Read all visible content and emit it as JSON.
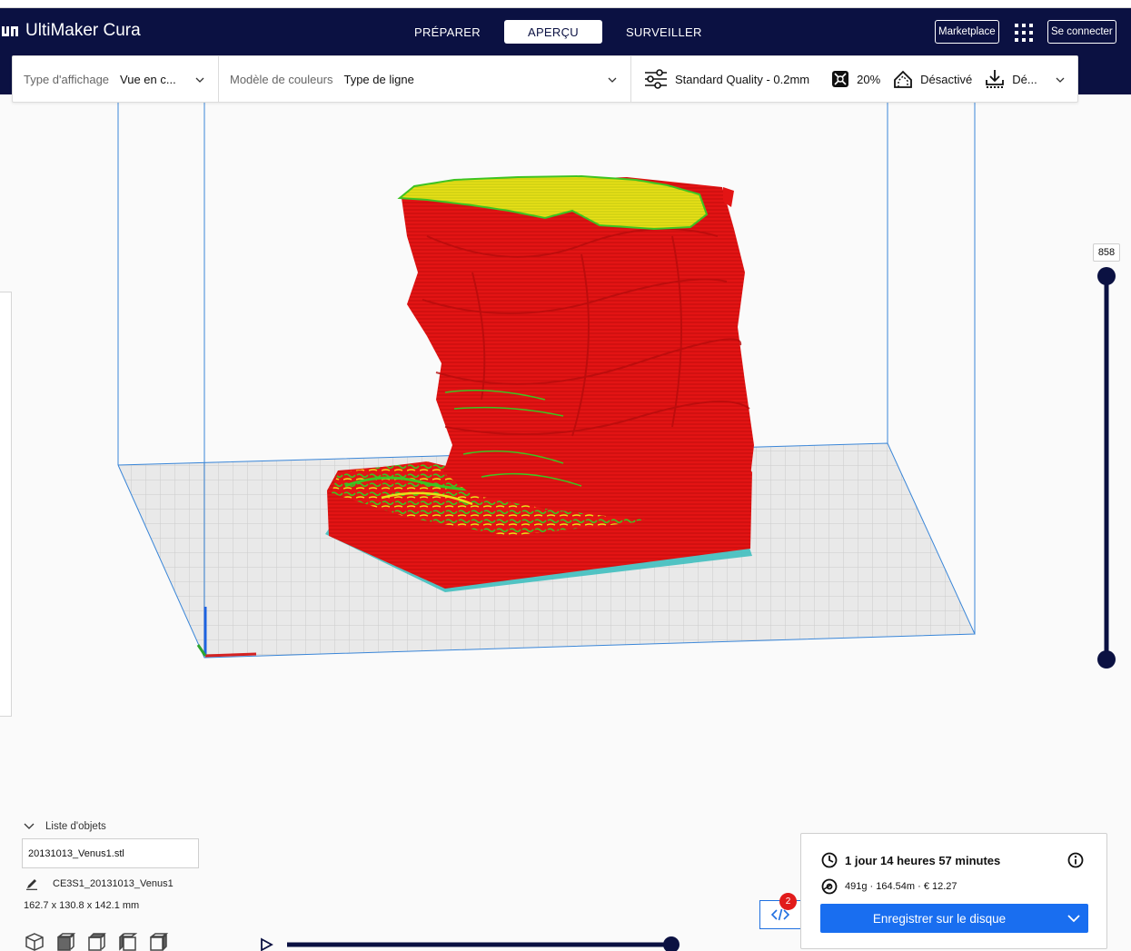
{
  "app": {
    "title": "UltiMaker Cura"
  },
  "stages": [
    {
      "label": "PRÉPARER",
      "active": false
    },
    {
      "label": "APERÇU",
      "active": true
    },
    {
      "label": "SURVEILLER",
      "active": false
    }
  ],
  "header": {
    "marketplace_label": "Marketplace",
    "signin_label": "Se connecter"
  },
  "toolbar": {
    "view_type_label": "Type d'affichage",
    "view_type_value": "Vue en c...",
    "color_scheme_label": "Modèle de couleurs",
    "color_scheme_value": "Type de ligne",
    "quality_label": "Standard Quality - 0.2mm",
    "infill_label": "20%",
    "support_label": "Désactivé",
    "adhesion_label": "Dé..."
  },
  "layer_slider": {
    "current_layer": "858"
  },
  "objects": {
    "header_label": "Liste d'objets",
    "file_name": "20131013_Venus1.stl",
    "profile_name": "CE3S1_20131013_Venus1",
    "dimensions": "162.7 x 130.8 x 142.1 mm"
  },
  "notifications": {
    "count": "2"
  },
  "print": {
    "time": "1 jour 14 heures 57 minutes",
    "material": "491g · 164.54m · € 12.27",
    "save_label": "Enregistrer sur le disque"
  },
  "colors": {
    "header_bg": "#0b1142",
    "accent_blue": "#196ef0",
    "model_red": "#e31414",
    "model_yellow": "#e8e017",
    "model_green": "#3ec321",
    "build_volume_line": "#3a86d8",
    "badge_red": "#e11b1b"
  },
  "icons": {
    "logo": "ultimaker-logo-icon",
    "apps": "apps-grid-icon",
    "quality": "sliders-icon",
    "infill": "infill-icon",
    "support": "support-icon",
    "adhesion": "adhesion-icon",
    "time": "clock-icon",
    "material": "spool-icon",
    "info": "info-icon",
    "gcode": "code-icon",
    "edit": "pencil-icon",
    "play": "play-icon"
  }
}
